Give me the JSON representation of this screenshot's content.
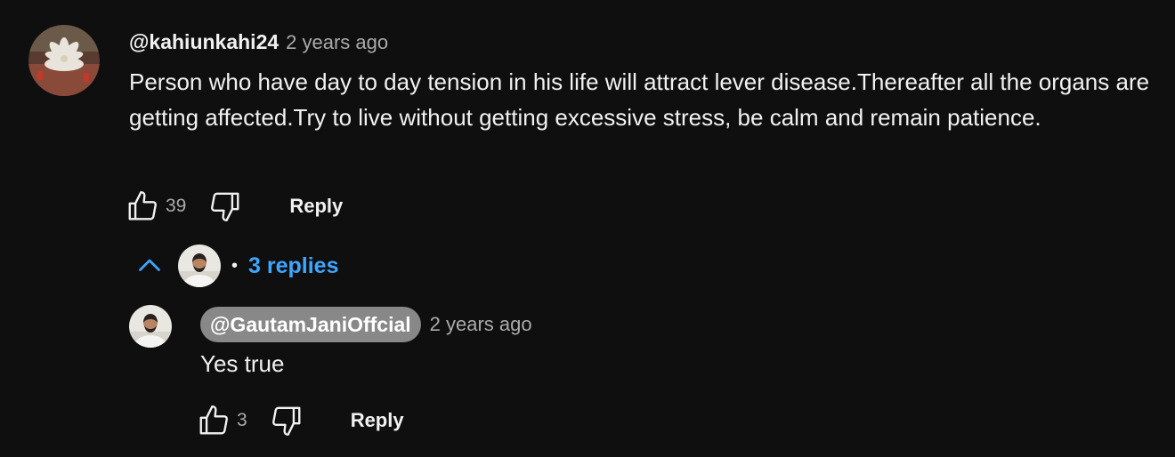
{
  "comment": {
    "author": "@kahiunkahi24",
    "time": "2 years ago",
    "text": "Person who have day to day tension in his life will attract lever disease.Thereafter all the organs are getting affected.Try to live without getting excessive stress, be calm and remain patience.",
    "likes": "39",
    "reply_label": "Reply",
    "avatar_icon": "flower-avatar-icon"
  },
  "replies_toggle": {
    "bullet": "•",
    "label": "3 replies",
    "color": "#3ea6ff"
  },
  "reply": {
    "author": "@GautamJaniOffcial",
    "time": "2 years ago",
    "text": "Yes true",
    "likes": "3",
    "reply_label": "Reply",
    "avatar_icon": "person-avatar-icon"
  },
  "colors": {
    "background": "#0f0f0f",
    "text": "#f1f1f1",
    "secondary": "#aaaaaa",
    "chip": "#888888",
    "link": "#3ea6ff"
  }
}
